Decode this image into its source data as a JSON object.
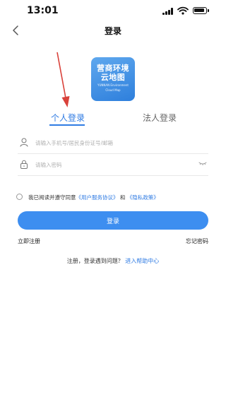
{
  "status_bar": {
    "time": "13:01"
  },
  "nav": {
    "title": "登录"
  },
  "logo": {
    "line1": "营商环境",
    "line2": "云地图",
    "en_line1": "YUNNAN Environment",
    "en_line2": "Cloud Map"
  },
  "tabs": [
    {
      "label": "个人登录",
      "active": true
    },
    {
      "label": "法人登录",
      "active": false
    }
  ],
  "form": {
    "account_placeholder": "请输入手机号/居民身份证号/邮箱",
    "account_value": "",
    "password_placeholder": "请输入密码",
    "password_value": ""
  },
  "agreement": {
    "prefix": "我已阅读并遵守同意",
    "user_agreement": "《用户服务协议》",
    "and": "和",
    "privacy_policy": "《隐私政策》",
    "checked": false
  },
  "login_button": "登录",
  "register": "立即注册",
  "forgot": "忘记密码",
  "help": {
    "text": "注册，登录遇到问题？",
    "link": "进入帮助中心"
  },
  "colors": {
    "accent": "#2f7be3",
    "button": "#3d8ef0",
    "annotation": "#d9413a"
  },
  "icons": [
    "back-icon",
    "user-icon",
    "lock-icon",
    "eye-closed-icon",
    "cellular-signal-icon",
    "wifi-icon",
    "battery-icon"
  ]
}
